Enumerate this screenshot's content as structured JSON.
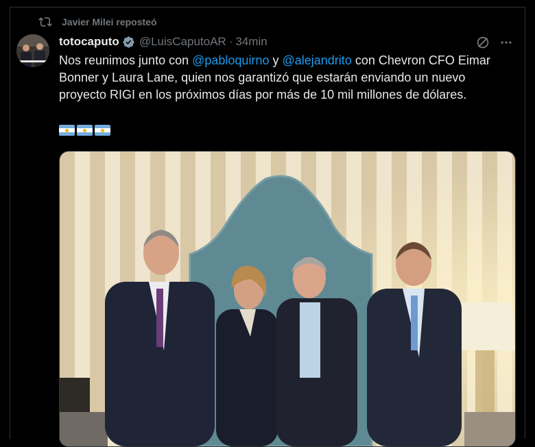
{
  "repost": {
    "label": "Javier Milei reposteó",
    "icon": "repost-icon"
  },
  "tweet": {
    "display_name": "totocaputo",
    "verified": true,
    "handle": "@LuisCaputoAR",
    "separator": "·",
    "time": "34min",
    "text_parts": {
      "p1": "Nos reunimos junto con ",
      "mention1": "@pabloquirno",
      "p2": " y ",
      "mention2": "@alejandrito",
      "p3": " con Chevron CFO Eimar Bonner y Laura Lane, quien nos garantizó que estarán enviando un nuevo proyecto RIGI en los próximos días por más de 10 mil millones de dólares."
    },
    "flags": [
      "argentina-flag",
      "argentina-flag",
      "argentina-flag"
    ]
  },
  "colors": {
    "background": "#000000",
    "text": "#e7e9ea",
    "secondary": "#71767b",
    "link": "#1d9bf0",
    "verified": "#829aab"
  },
  "icons": {
    "grok": "grok-icon",
    "more": "more-icon",
    "verified": "verified-badge-icon"
  }
}
